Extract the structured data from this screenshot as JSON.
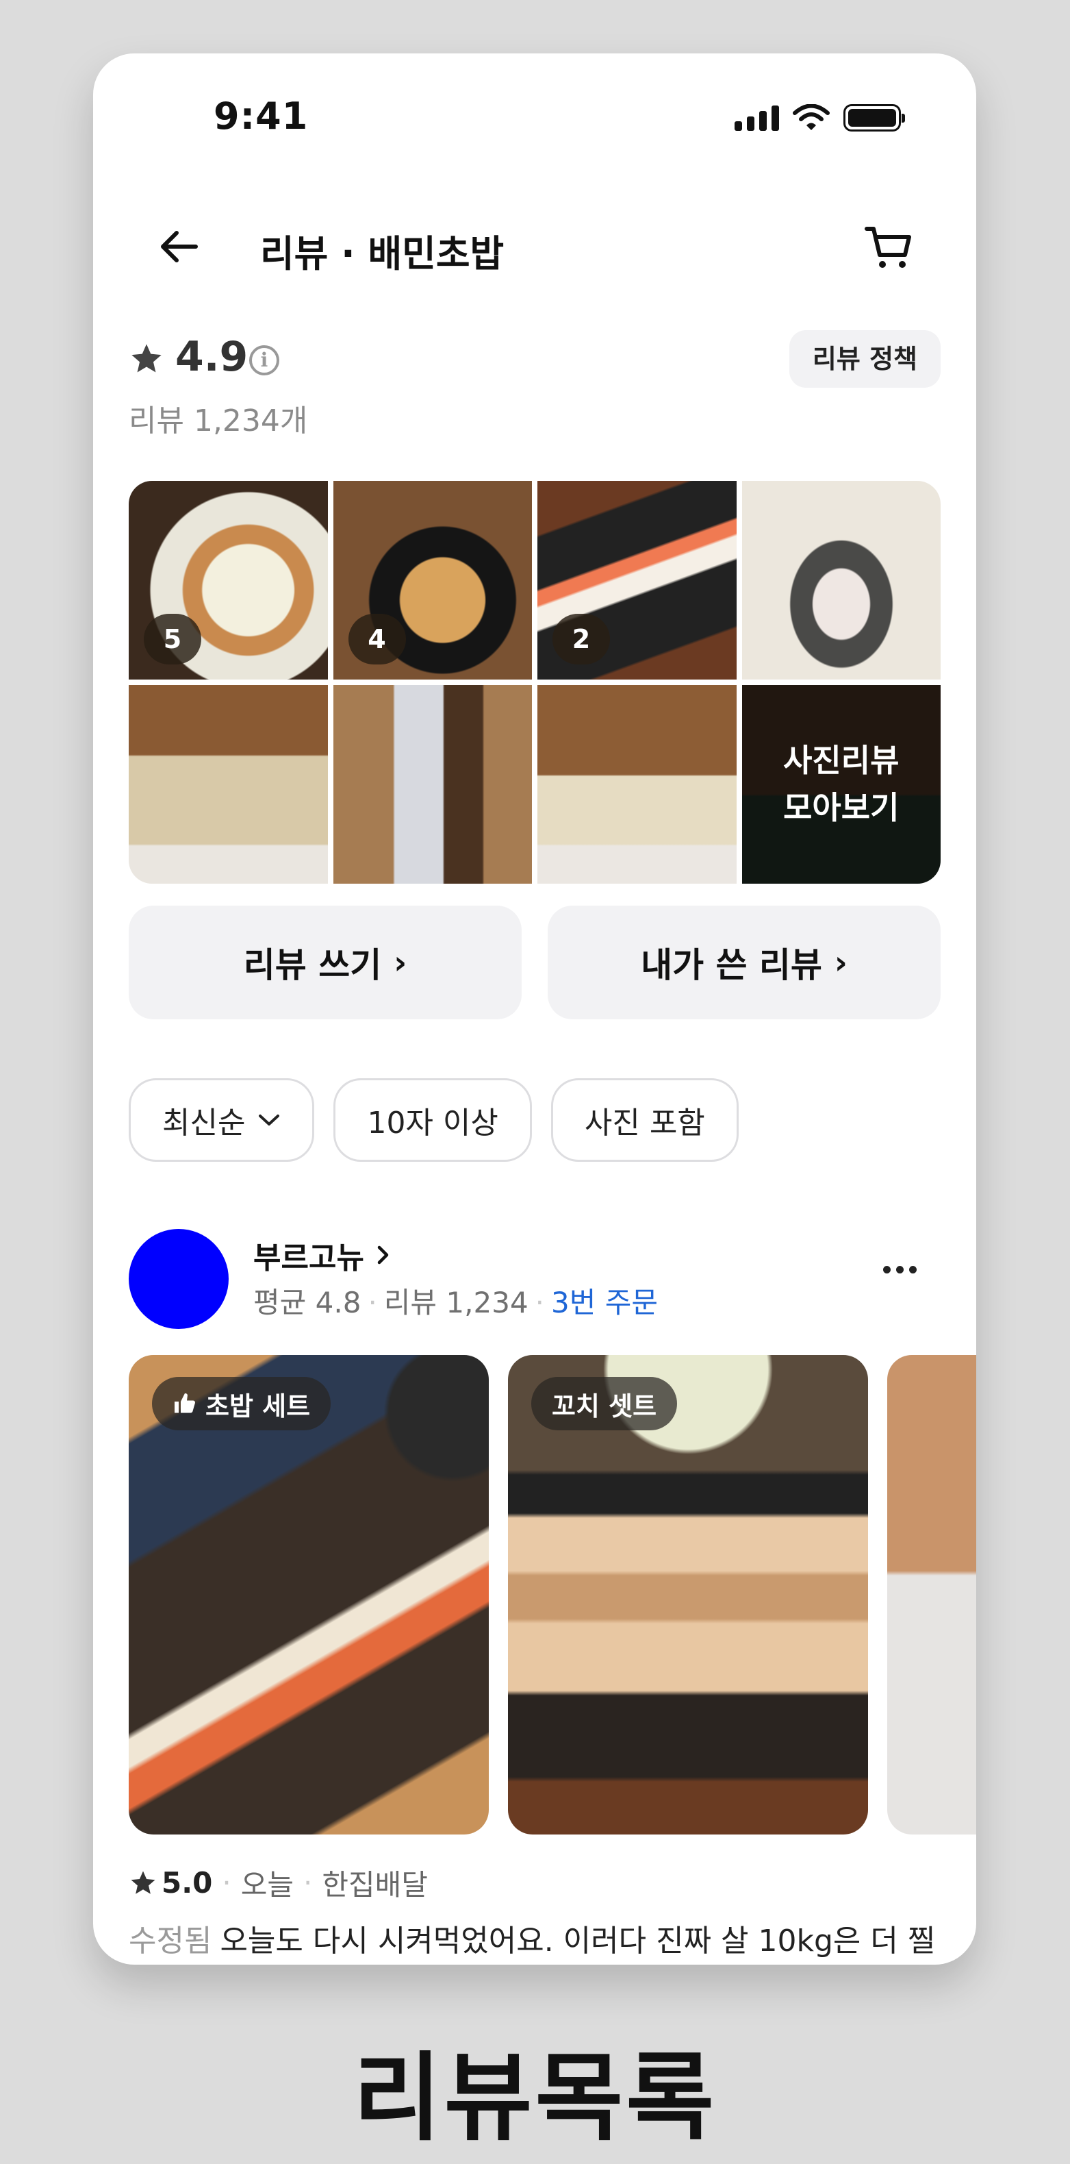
{
  "status_bar": {
    "time": "9:41"
  },
  "header": {
    "title": "리뷰 · 배민초밥"
  },
  "rating": {
    "value": "4.9",
    "review_count": "리뷰 1,234개",
    "policy_label": "리뷰 정책"
  },
  "photos": {
    "counts": [
      "5",
      "4",
      "2"
    ],
    "more_label": "사진리뷰\n모아보기"
  },
  "actions": {
    "write": "리뷰 쓰기",
    "mine": "내가 쓴 리뷰",
    "chevron": "›"
  },
  "filters": {
    "sort": "최신순",
    "min_length": "10자 이상",
    "with_photo": "사진 포함"
  },
  "review": {
    "reviewer": "부르고뉴",
    "avg_rating": "평균 4.8",
    "reviews": "리뷰 1,234",
    "orders": "3번 주문",
    "avatar_color": "#0000ff",
    "tags": [
      "초밥 세트",
      "꼬치 셋트"
    ],
    "score": "5.0",
    "date": "오늘",
    "delivery": "한집배달",
    "edited": "수정됨",
    "text": "오늘도 다시 시켜먹었어요. 이러다 진짜 살 10kg은 더 찔"
  },
  "caption": "리뷰목록"
}
